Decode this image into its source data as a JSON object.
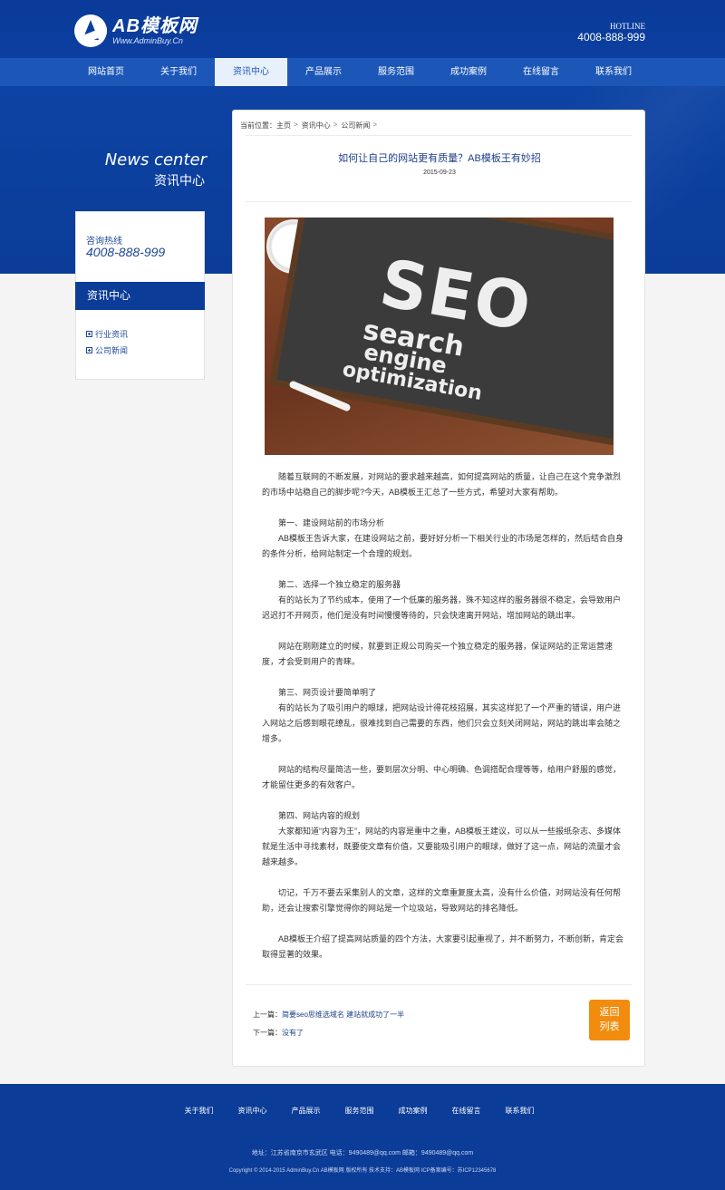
{
  "header": {
    "logo_title": "AB模板网",
    "logo_sub": "Www.AdminBuy.Cn",
    "hotline_label": "HOTLINE",
    "hotline_number": "4008-888-999"
  },
  "nav": {
    "items": [
      "网站首页",
      "关于我们",
      "资讯中心",
      "产品展示",
      "服务范围",
      "成功案例",
      "在线留言",
      "联系我们"
    ],
    "active_index": 2
  },
  "banner": {
    "en": "News center",
    "cn": "资讯中心"
  },
  "sidebar": {
    "hotline_label": "咨询热线",
    "hotline_number": "4008-888-999",
    "category_title": "资讯中心",
    "links": [
      "行业资讯",
      "公司新闻"
    ]
  },
  "article": {
    "breadcrumb": [
      "当前位置：主页",
      "资讯中心",
      "公司新闻"
    ],
    "title": "如何让自己的网站更有质量？AB模板王有妙招",
    "date": "2015-09-23",
    "image_icon": "seo-chalkboard-photo",
    "image_words": {
      "big1": "SEO",
      "big2": "search",
      "big3": "engine",
      "big4": "optimization"
    },
    "paragraphs": [
      "随着互联网的不断发展，对网站的要求越来越高，如何提高网站的质量，让自己在这个竞争激烈的市场中站稳自己的脚步呢?今天，AB模板王汇总了一些方式，希望对大家有帮助。",
      "",
      "第一、建设网站前的市场分析",
      "AB模板王告诉大家，在建设网站之前，要好好分析一下相关行业的市场是怎样的，然后结合自身的条件分析，给网站制定一个合理的规划。",
      "",
      "第二、选择一个独立稳定的服务器",
      "有的站长为了节约成本，使用了一个低廉的服务器，殊不知这样的服务器很不稳定，会导致用户迟迟打不开网页，他们是没有时间慢慢等待的，只会快速离开网站，增加网站的跳出率。",
      "",
      "网站在刚刚建立的时候，就要到正规公司购买一个独立稳定的服务器，保证网站的正常运营速度，才会受到用户的青睐。",
      "",
      "第三、网页设计要简单明了",
      "有的站长为了吸引用户的眼球，把网站设计得花枝招展，其实这样犯了一个严重的错误，用户进入网站之后感到眼花缭乱，很难找到自己需要的东西，他们只会立刻关闭网站，网站的跳出率会随之增多。",
      "",
      "网站的结构尽量简洁一些，要到层次分明、中心明确、色调搭配合理等等，给用户舒服的感觉，才能留住更多的有效客户。",
      "",
      "第四、网站内容的规划",
      "大家都知道“内容为王”，网站的内容是重中之重，AB模板王建议，可以从一些报纸杂志、多媒体就是生活中寻找素材，既要使文章有价值，又要能吸引用户的眼球，做好了这一点，网站的流量才会越来越多。",
      "",
      "切记，千万不要去采集别人的文章，这样的文章重复度太高，没有什么价值，对网站没有任何帮助，还会让搜索引擎觉得你的网站是一个垃圾站，导致网站的排名降低。",
      "",
      "AB模板王介绍了提高网站质量的四个方法，大家要引起重视了，并不断努力，不断创新，肯定会取得显著的效果。"
    ],
    "prev_label": "上一篇：",
    "prev_title": "简要seo思维选域名 建站就成功了一半",
    "next_label": "下一篇：",
    "next_title": "没有了",
    "back_line1": "返回",
    "back_line2": "列表"
  },
  "footer": {
    "nav": [
      "关于我们",
      "资讯中心",
      "产品展示",
      "服务范围",
      "成功案例",
      "在线留言",
      "联系我们"
    ],
    "address": "地址：江苏省南京市玄武区  电话：9490489@qq.com  邮箱：9490489@qq.com",
    "copyright": "Copyright © 2014-2015 AdminBuy.Cn  AB模板网 版权所有  技术支持：AB模板网  ICP备案编号：苏ICP12345678"
  },
  "colors": {
    "brand_blue": "#0b3c98",
    "nav_blue": "#1c57b8",
    "accent_orange": "#f28c0e"
  }
}
